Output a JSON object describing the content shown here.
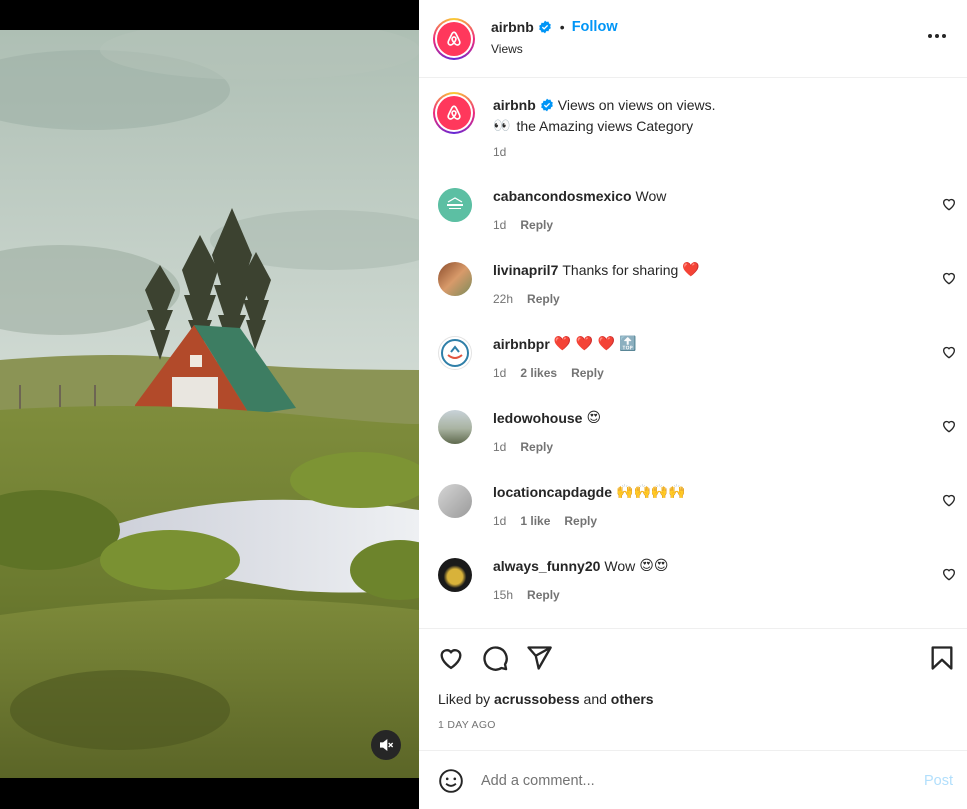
{
  "colors": {
    "brand": "#ff385c",
    "link": "#0095f6",
    "muted": "#737373",
    "heart": "#ed4956",
    "post_disabled": "#b2dffc"
  },
  "media": {
    "mute_icon": "speaker-muted-icon"
  },
  "header": {
    "username": "airbnb",
    "follow_label": "Follow",
    "subtitle": "Views",
    "verified_icon": "verified-badge-icon",
    "more_icon": "more-horizontal-icon"
  },
  "caption": {
    "username": "airbnb",
    "text": "Views on views on views.",
    "line2_emoji": "👀",
    "line2_text": "the Amazing views Category",
    "time": "1d"
  },
  "comments": [
    {
      "username": "cabancondosmexico",
      "text": "Wow",
      "emoji": "",
      "time": "1d",
      "likes": "",
      "reply": "Reply"
    },
    {
      "username": "livinapril7",
      "text": "Thanks for sharing",
      "emoji": "❤️",
      "time": "22h",
      "likes": "",
      "reply": "Reply"
    },
    {
      "username": "airbnbpr",
      "text": "",
      "emoji": "❤️ ❤️ ❤️ 🔝",
      "time": "1d",
      "likes": "2 likes",
      "reply": "Reply"
    },
    {
      "username": "ledowohouse",
      "text": "",
      "emoji": "😍",
      "time": "1d",
      "likes": "",
      "reply": "Reply"
    },
    {
      "username": "locationcapdagde",
      "text": "",
      "emoji": "🙌🙌🙌🙌",
      "time": "1d",
      "likes": "1 like",
      "reply": "Reply"
    },
    {
      "username": "always_funny20",
      "text": "Wow",
      "emoji": "😍😍",
      "time": "15h",
      "likes": "",
      "reply": "Reply"
    }
  ],
  "actions": {
    "like_icon": "heart-outline-icon",
    "comment_icon": "comment-bubble-icon",
    "share_icon": "paper-plane-icon",
    "save_icon": "bookmark-icon",
    "liked_prefix": "Liked by",
    "liked_user": "acrussobess",
    "liked_and": "and",
    "liked_others": "others",
    "time_ago": "1 DAY AGO"
  },
  "composer": {
    "placeholder": "Add a comment...",
    "post_label": "Post",
    "emoji_icon": "smiley-icon"
  }
}
